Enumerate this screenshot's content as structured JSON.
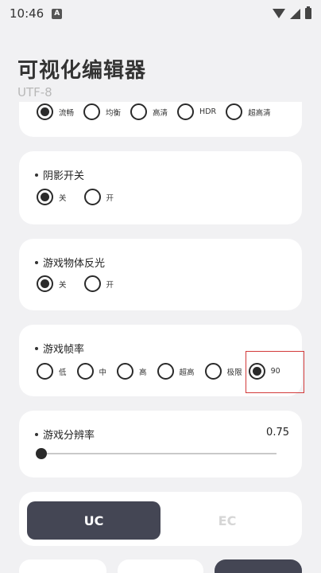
{
  "status_bar": {
    "time": "10:46",
    "notification_badge": "A"
  },
  "header": {
    "title": "可视化编辑器",
    "subtitle": "UTF-8"
  },
  "quality_card": {
    "options": [
      {
        "label": "流畅",
        "checked": true
      },
      {
        "label": "均衡",
        "checked": false
      },
      {
        "label": "高清",
        "checked": false
      },
      {
        "label": "HDR",
        "checked": false
      },
      {
        "label": "超高清",
        "checked": false
      }
    ]
  },
  "shadow_card": {
    "title": "阴影开关",
    "options": [
      {
        "label": "关",
        "checked": true
      },
      {
        "label": "开",
        "checked": false
      }
    ]
  },
  "reflection_card": {
    "title": "游戏物体反光",
    "options": [
      {
        "label": "关",
        "checked": true
      },
      {
        "label": "开",
        "checked": false
      }
    ]
  },
  "framerate_card": {
    "title": "游戏帧率",
    "options": [
      {
        "label": "低",
        "checked": false
      },
      {
        "label": "中",
        "checked": false
      },
      {
        "label": "高",
        "checked": false
      },
      {
        "label": "超高",
        "checked": false
      },
      {
        "label": "极限",
        "checked": false
      },
      {
        "label": "90",
        "checked": true
      }
    ]
  },
  "resolution_card": {
    "title": "游戏分辨率",
    "value": "0.75",
    "slider_fraction": 0.0
  },
  "segment": {
    "active_label": "UC",
    "inactive_label": "EC"
  },
  "colors": {
    "background": "#f1f1f3",
    "card": "#ffffff",
    "accent_dark": "#444654",
    "highlight": "#d23a3a"
  }
}
